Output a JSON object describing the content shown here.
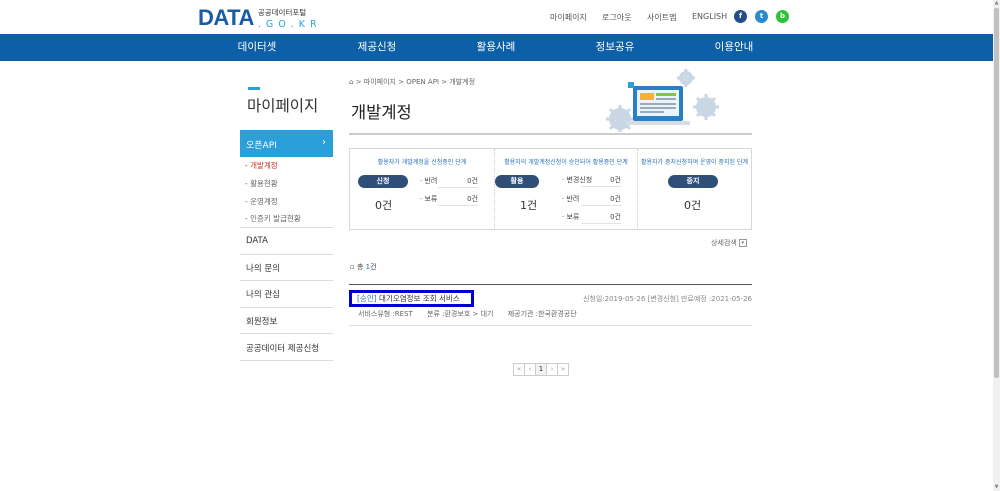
{
  "logo": {
    "main": "DATA",
    "sub1": "공공데이터포털",
    "sub2": ". G O . K R"
  },
  "util": {
    "mypage": "마이페이지",
    "logout": "로그아웃",
    "sitemap": "사이트맵",
    "english": "ENGLISH"
  },
  "sns": {
    "facebook": "f",
    "twitter": "t",
    "blog": "b"
  },
  "gnb": [
    "데이터셋",
    "제공신청",
    "활용사례",
    "정보공유",
    "이용안내"
  ],
  "sidebar": {
    "title": "마이페이지",
    "active": "오픈API",
    "active_arrow": "›",
    "subs": [
      "- 개발계정",
      "- 활용현황",
      "- 운영계정",
      "- 인증키 발급현황"
    ],
    "items": [
      "DATA",
      "나의 문의",
      "나의 관심",
      "회원정보",
      "공공데이터 제공신청"
    ]
  },
  "breadcrumb": {
    "home": "⌂",
    "path": "> 마이페이지 > OPEN API > 개발계정"
  },
  "page_title": "개발계정",
  "status": {
    "apply": {
      "desc": "활용자가 개발계정을 신청중인 단계",
      "label": "신청",
      "count": "0건",
      "sub": [
        {
          "label": "· 반려",
          "value": "0건"
        },
        {
          "label": "· 보류",
          "value": "0건"
        }
      ]
    },
    "use": {
      "desc": "활용자의 개발계정신청이 승인되어 활용중인 단계",
      "label": "활용",
      "count": "1건",
      "sub": [
        {
          "label": "· 변경신청",
          "value": "0건"
        },
        {
          "label": "· 반려",
          "value": "0건"
        },
        {
          "label": "· 보류",
          "value": "0건"
        }
      ]
    },
    "stop": {
      "desc": "활용자가 중지신청하여 운영이 중지된 단계",
      "label": "중지",
      "count": "0건"
    }
  },
  "detail_search": "상세검색",
  "detail_icon": "▾",
  "total": {
    "icon": "▫",
    "prefix": "총",
    "count": "1",
    "suffix": "건"
  },
  "result": {
    "tag": "[승인]",
    "name": "대기오염정보 조회 서비스",
    "dates": "신청일:2019-05-26 [변경신청] 만료예정 :2021-05-26",
    "type": "서비스유형 :REST",
    "category": "분류 :환경보호 > 대기",
    "provider": "제공기관 :한국환경공단"
  },
  "paging": {
    "first": "«",
    "prev": "‹",
    "page": "1",
    "next": "›",
    "last": "»"
  },
  "colors": {
    "gnb": "#0d5fa7",
    "accent": "#2b9fd9",
    "pill": "#2f4f79",
    "highlight": "#0000cc"
  }
}
